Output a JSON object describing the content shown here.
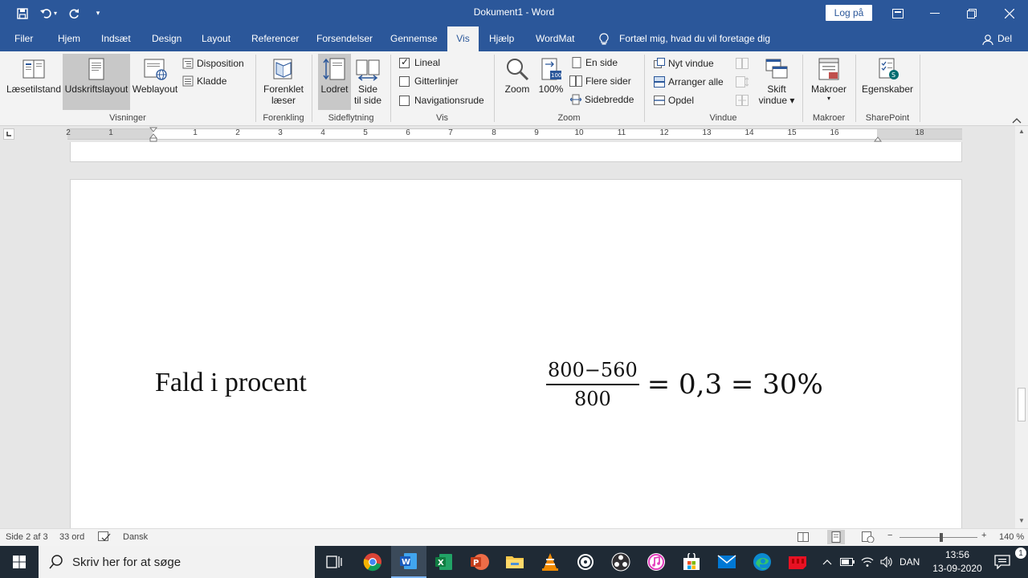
{
  "titlebar": {
    "doc_title": "Dokument1  -  Word",
    "login_label": "Log på",
    "qa_more": "▾"
  },
  "tabs": [
    {
      "label": "Filer"
    },
    {
      "label": "Hjem"
    },
    {
      "label": "Indsæt"
    },
    {
      "label": "Design"
    },
    {
      "label": "Layout"
    },
    {
      "label": "Referencer"
    },
    {
      "label": "Forsendelser"
    },
    {
      "label": "Gennemse"
    },
    {
      "label": "Vis"
    },
    {
      "label": "Hjælp"
    },
    {
      "label": "WordMat"
    }
  ],
  "tellme": "Fortæl mig, hvad du vil foretage dig",
  "share": "Del",
  "ribbon": {
    "visninger": {
      "label": "Visninger",
      "read_mode": "Læsetilstand",
      "print_layout": "Udskriftslayout",
      "web_layout": "Weblayout",
      "outline": "Disposition",
      "draft": "Kladde"
    },
    "forenkling": {
      "label": "Forenkling",
      "line1": "Forenklet",
      "line2": "læser"
    },
    "sideflytning": {
      "label": "Sideflytning",
      "vertical": "Lodret",
      "side_line1": "Side",
      "side_line2": "til side"
    },
    "vis": {
      "label": "Vis",
      "ruler": "Lineal",
      "gridlines": "Gitterlinjer",
      "navpane": "Navigationsrude"
    },
    "zoom": {
      "label": "Zoom",
      "zoom": "Zoom",
      "hundred": "100%",
      "one_page": "En side",
      "multi_pages": "Flere sider",
      "page_width": "Sidebredde"
    },
    "vindue": {
      "label": "Vindue",
      "new_window": "Nyt vindue",
      "arrange_all": "Arranger alle",
      "split": "Opdel",
      "switch_line1": "Skift",
      "switch_line2": "vindue ▾"
    },
    "makroer": {
      "label": "Makroer",
      "macros": "Makroer",
      "macros_arrow": "▾"
    },
    "sharepoint": {
      "label": "SharePoint",
      "properties": "Egenskaber"
    }
  },
  "ruler_numbers": [
    "2",
    "1",
    "1",
    "2",
    "3",
    "4",
    "5",
    "6",
    "7",
    "8",
    "9",
    "10",
    "11",
    "12",
    "13",
    "14",
    "15",
    "16",
    "18"
  ],
  "document": {
    "text": "Fald i procent",
    "formula_numerator": "800−560",
    "formula_denominator": "800",
    "formula_rest": "= 0,3 = 30%"
  },
  "statusbar": {
    "page": "Side 2 af 3",
    "words": "33 ord",
    "language": "Dansk",
    "zoom_minus": "−",
    "zoom_plus": "+",
    "zoom": "140 %"
  },
  "taskbar": {
    "search_placeholder": "Skriv her for at søge",
    "language": "DAN",
    "time": "13:56",
    "date": "13-09-2020"
  },
  "colors": {
    "accent": "#2b579a",
    "ribbon": "#f3f3f3",
    "taskbar": "#1f2a35"
  }
}
